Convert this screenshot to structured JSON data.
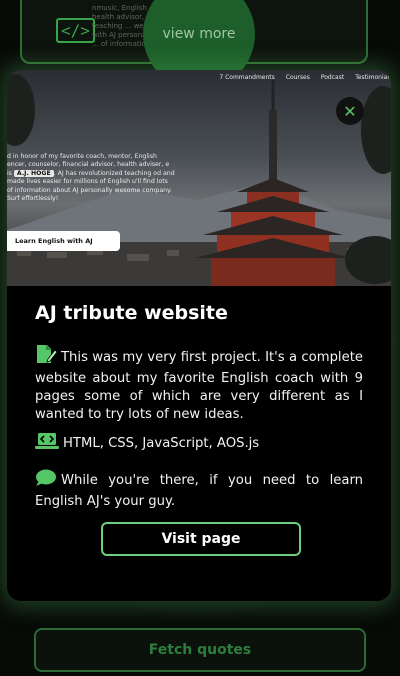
{
  "background": {
    "view_more_label": "view more",
    "code_icon": "</>",
    "card_text": "nmusic, English ... health advisor, ... teaching ... website with AJ personally ... of information",
    "fetch_quotes_label": "Fetch quotes"
  },
  "modal": {
    "hero": {
      "nav": [
        "7 Commandments",
        "Courses",
        "Podcast",
        "Testimonial"
      ],
      "text_before_tag": "d in honor of my favorite coach, mentor, English encer, counselor, financial advisor, health adviser, e is ",
      "tag": "A.J. HOGE",
      "text_after_tag": ". AJ has revolutionized teaching od and made lives easier for millions of English u'll find lots of information about AJ personally wesome company. Surf effortlessly!",
      "button_label": "Learn English with AJ"
    },
    "close_label": "✕",
    "title": "AJ tribute website",
    "paragraph1": "This was my very first project. It's a complete website about my favorite English coach with 9 pages some of which are very different as I wanted to try lots of new ideas.",
    "paragraph2": "HTML, CSS, JavaScript, AOS.js",
    "paragraph3": "While you're there, if you need to learn English AJ's your guy.",
    "visit_label": "Visit page",
    "icons": {
      "p1": "edit-document-icon",
      "p2": "laptop-code-icon",
      "p3": "chat-bubble-icon"
    },
    "colors": {
      "accent": "#55c766",
      "button_border": "#6fcf7c"
    }
  }
}
